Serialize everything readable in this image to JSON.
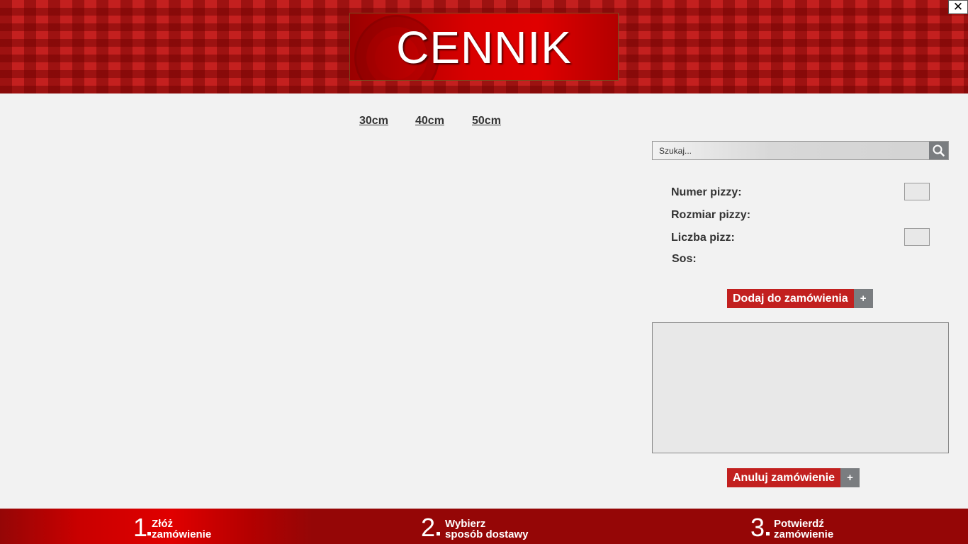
{
  "header": {
    "title": "CENNIK",
    "close_label": "✕"
  },
  "size_tabs": [
    "30cm",
    "40cm",
    "50cm"
  ],
  "search": {
    "placeholder": "Szukaj...",
    "icon": "search-icon"
  },
  "order_form": {
    "pizza_number_label": "Numer pizzy:",
    "pizza_size_label": "Rozmiar pizzy:",
    "pizza_count_label": "Liczba pizz:",
    "sauce_label": "Sos:",
    "add_button_label": "Dodaj do zamówienia",
    "add_button_icon": "+",
    "cancel_button_label": "Anuluj zamówienie",
    "cancel_button_icon": "+"
  },
  "steps": [
    {
      "number": "1",
      "line1": "Złóż",
      "line2": "zamówienie",
      "active": true
    },
    {
      "number": "2",
      "line1": "Wybierz",
      "line2": "sposób dostawy",
      "active": false
    },
    {
      "number": "3",
      "line1": "Potwierdź",
      "line2": "zamówienie",
      "active": false
    }
  ],
  "colors": {
    "brand_red": "#c2201f",
    "footer_red": "#950606",
    "button_gray": "#7a7d80",
    "background": "#f2f2f2"
  }
}
